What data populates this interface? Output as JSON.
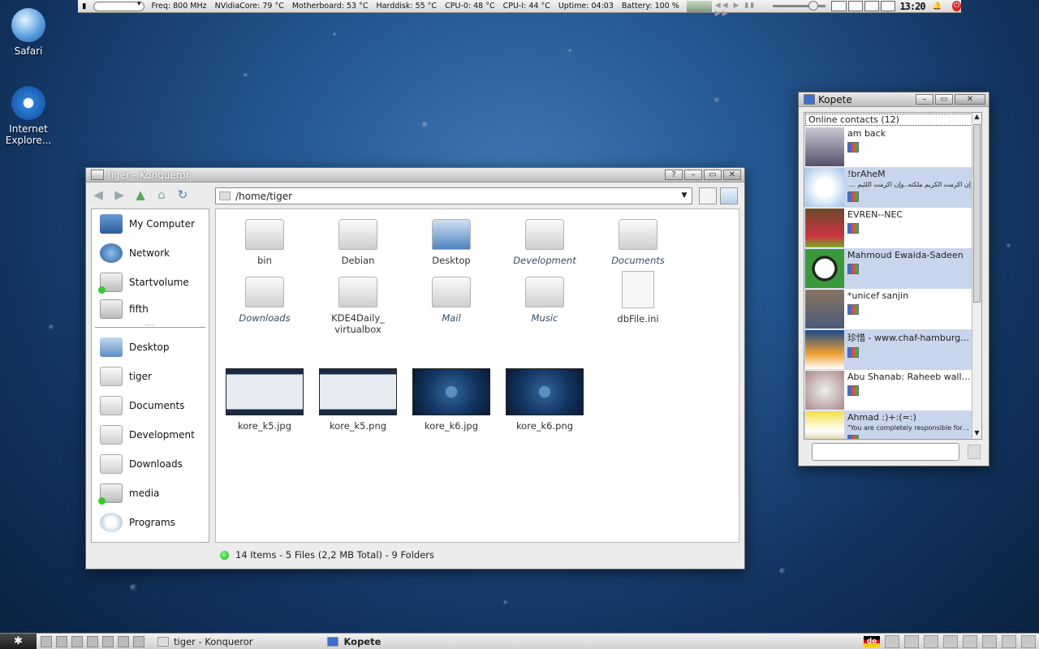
{
  "colors": {
    "desktop": "#245690",
    "contact_alt_bg": "#c8d5ec",
    "status_green": "#2a2"
  },
  "topbar": {
    "freq": "Freq: 800 MHz",
    "nvidia": "NVidiaCore: 79 °C",
    "motherboard": "Motherboard: 53 °C",
    "harddisk": "Harddisk: 55 °C",
    "cpu0": "CPU-0: 48 °C",
    "cpu1": "CPU-I: 44 °C",
    "uptime": "Uptime: 04:03",
    "battery": "Battery: 100 %",
    "clock": "13:20"
  },
  "desktop_icons": [
    {
      "label": "Safari",
      "icon": "safari-globe-icon"
    },
    {
      "label": "Internet Explore...",
      "icon": "internet-explorer-icon"
    }
  ],
  "konqueror": {
    "title": "tiger - Konqueror",
    "location": "/home/tiger",
    "sidebar": {
      "devices": [
        "My Computer",
        "Network",
        "Startvolume",
        "fifth"
      ],
      "places": [
        "Desktop",
        "tiger",
        "Documents",
        "Development",
        "Downloads",
        "media",
        "Programs"
      ]
    },
    "files_row1": [
      "bin",
      "Debian",
      "Desktop",
      "Development",
      "Documents"
    ],
    "files_row2": [
      "Downloads",
      "KDE4Daily_\nvirtualbox",
      "Mail",
      "Music",
      "dbFile.ini"
    ],
    "thumbs": [
      "kore_k5.jpg",
      "kore_k5.png",
      "kore_k6.jpg",
      "kore_k6.png"
    ],
    "status": "14 Items - 5 Files (2,2 MB Total) - 9 Folders"
  },
  "kopete": {
    "title": "Kopete",
    "group": "Online contacts (12)",
    "contacts": [
      {
        "name": "am back",
        "msg": ""
      },
      {
        "name": "!brAheM",
        "msg": "إن اكرمت الكريم ملكته..وإن اكرمت اللئيم تمرد"
      },
      {
        "name": "EVREN--NEC",
        "msg": ""
      },
      {
        "name": "Mahmoud Ewaida-Sadeen",
        "msg": ""
      },
      {
        "name": "*unicef sanjin",
        "msg": ""
      },
      {
        "name": "珍惜 - www.chaf-hamburg.com",
        "msg": ""
      },
      {
        "name": "Abu Shanab: Raheeb wallah ...",
        "msg": ""
      },
      {
        "name": "Ahmad :)+:(=:)",
        "msg": "\"You are completely responsible for every..."
      }
    ]
  },
  "taskbar": {
    "tasks": [
      "tiger - Konqueror",
      "Kopete"
    ],
    "layout": "de"
  }
}
